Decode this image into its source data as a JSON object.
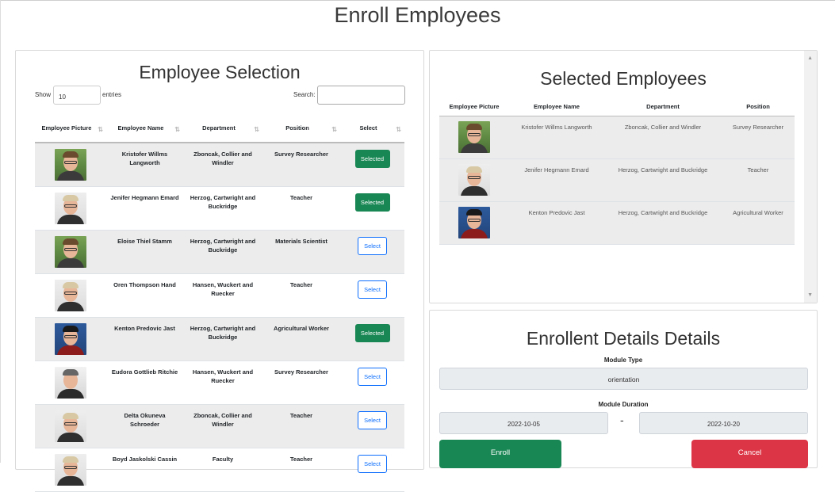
{
  "page": {
    "title": "Enroll Employees"
  },
  "employee_selection": {
    "title": "Employee Selection",
    "show_label": "Show",
    "entries_value": "10",
    "entries_label": "entries",
    "search_label": "Search:",
    "search_value": "",
    "columns": [
      "Employee Picture",
      "Employee Name",
      "Department",
      "Position",
      "Select"
    ],
    "rows": [
      {
        "name": "Kristofer Willms Langworth",
        "department": "Zboncak, Collier and Windler",
        "position": "Survey Researcher",
        "action": "Selected",
        "avatar": "green"
      },
      {
        "name": "Jenifer Hegmann Emard",
        "department": "Herzog, Cartwright and Buckridge",
        "position": "Teacher",
        "action": "Selected",
        "avatar": "light"
      },
      {
        "name": "Eloise Thiel Stamm",
        "department": "Herzog, Cartwright and Buckridge",
        "position": "Materials Scientist",
        "action": "Select",
        "avatar": "green"
      },
      {
        "name": "Oren Thompson Hand",
        "department": "Hansen, Wuckert and Ruecker",
        "position": "Teacher",
        "action": "Select",
        "avatar": "light"
      },
      {
        "name": "Kenton Predovic Jast",
        "department": "Herzog, Cartwright and Buckridge",
        "position": "Agricultural Worker",
        "action": "Selected",
        "avatar": "blue"
      },
      {
        "name": "Eudora Gottlieb Ritchie",
        "department": "Hansen, Wuckert and Ruecker",
        "position": "Survey Researcher",
        "action": "Select",
        "avatar": "gray"
      },
      {
        "name": "Delta Okuneva Schroeder",
        "department": "Zboncak, Collier and Windler",
        "position": "Teacher",
        "action": "Select",
        "avatar": "light"
      },
      {
        "name": "Boyd Jaskolski Cassin",
        "department": "Faculty",
        "position": "Teacher",
        "action": "Select",
        "avatar": "light"
      }
    ]
  },
  "selected_employees": {
    "title": "Selected Employees",
    "columns": [
      "Employee Picture",
      "Employee Name",
      "Department",
      "Position"
    ],
    "rows": [
      {
        "name": "Kristofer Willms Langworth",
        "department": "Zboncak, Collier and Windler",
        "position": "Survey Researcher",
        "avatar": "green"
      },
      {
        "name": "Jenifer Hegmann Emard",
        "department": "Herzog, Cartwright and Buckridge",
        "position": "Teacher",
        "avatar": "light"
      },
      {
        "name": "Kenton Predovic Jast",
        "department": "Herzog, Cartwright and Buckridge",
        "position": "Agricultural Worker",
        "avatar": "blue"
      }
    ]
  },
  "enrollment": {
    "title": "Enrollent Details Details",
    "module_type_label": "Module Type",
    "module_type_value": "orientation",
    "module_duration_label": "Module Duration",
    "start_date": "2022-10-05",
    "separator": "-",
    "end_date": "2022-10-20",
    "enroll_label": "Enroll",
    "cancel_label": "Cancel"
  },
  "colors": {
    "selected_green": "#198754",
    "select_blue": "#0d6efd",
    "cancel_red": "#dc3545"
  }
}
